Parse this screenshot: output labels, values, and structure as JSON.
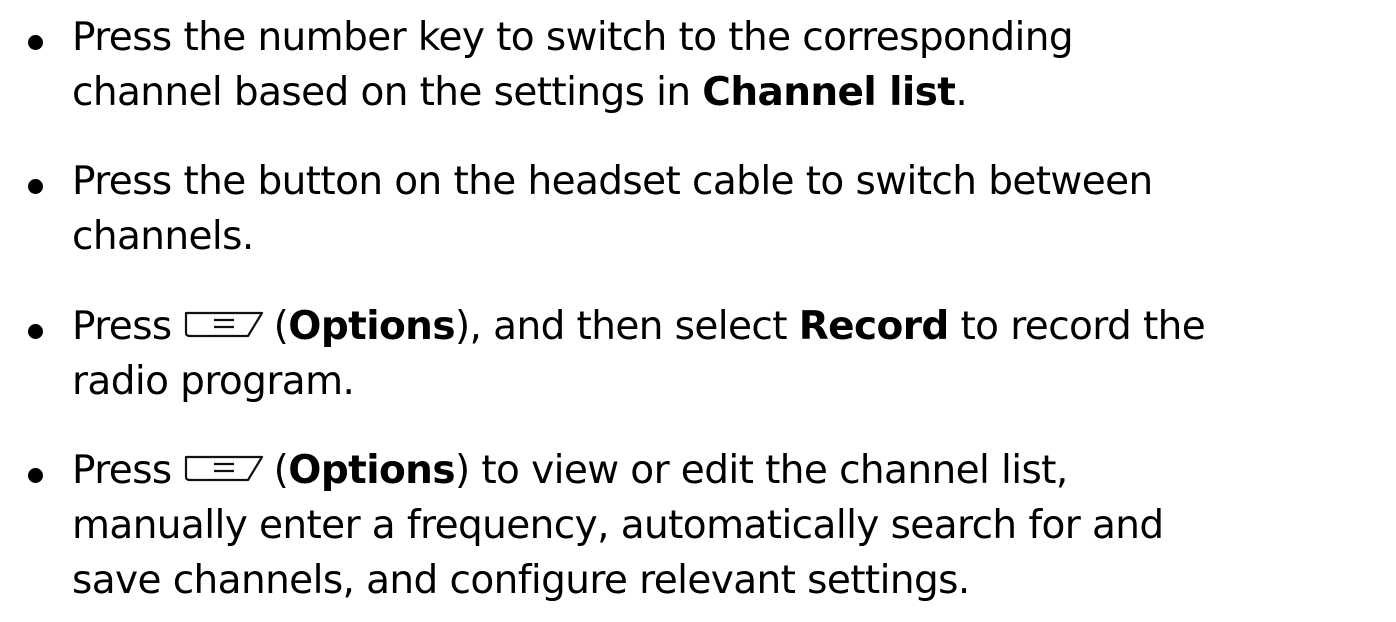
{
  "items": [
    {
      "line1": "Press the number key to switch to the corresponding",
      "line2_before": "channel based on the settings in ",
      "line2_bold": "Channel list",
      "line2_after": "."
    },
    {
      "line1": "Press the button on the headset cable to switch between",
      "line2": "channels."
    },
    {
      "line1_before": "Press",
      "line1_paren_open": "(",
      "line1_bold1": "Options",
      "line1_mid": "), and then select ",
      "line1_bold2": "Record",
      "line1_after": " to record the",
      "line2": "radio program."
    },
    {
      "line1_before": "Press",
      "line1_paren_open": "(",
      "line1_bold": "Options",
      "line1_after": ") to view or edit the channel list,",
      "line2": "manually enter a frequency, automatically search for and",
      "line3": "save channels, and configure relevant settings."
    }
  ],
  "icons": {
    "options_key": "left-soft-key-icon"
  }
}
